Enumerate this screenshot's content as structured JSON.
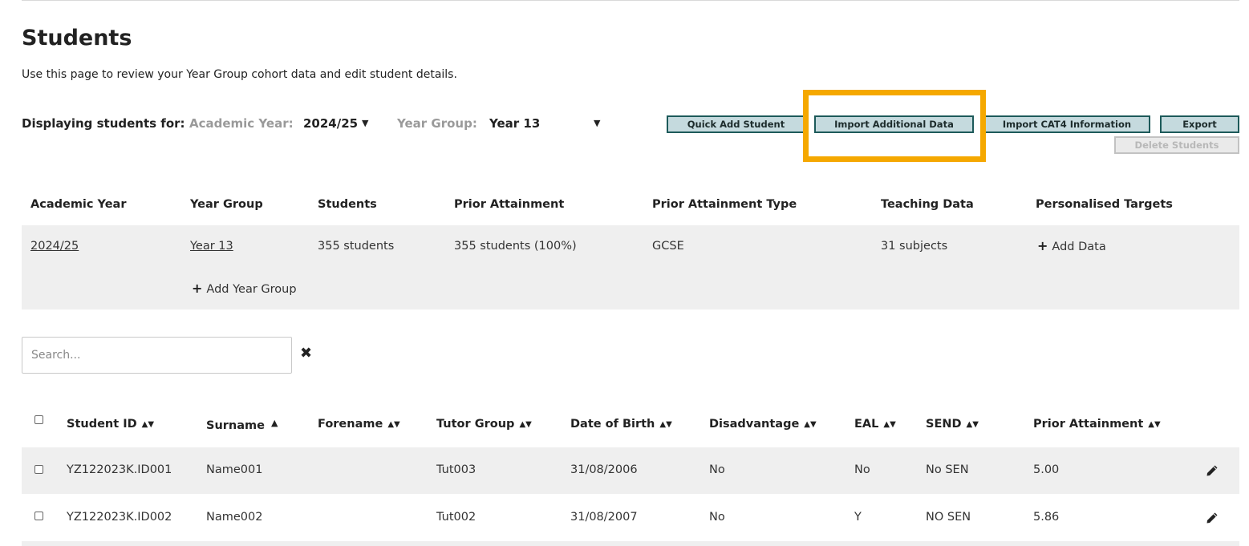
{
  "page": {
    "title": "Students",
    "subtitle": "Use this page to review your Year Group cohort data and edit student details."
  },
  "filters": {
    "displaying_label": "Displaying students for:",
    "academic_year_label": "Academic Year:",
    "academic_year_value": "2024/25",
    "year_group_label": "Year Group:",
    "year_group_value": "Year 13"
  },
  "actions": {
    "quick_add": "Quick Add Student",
    "import_additional": "Import Additional Data",
    "import_cat4": "Import CAT4 Information",
    "export": "Export",
    "delete": "Delete Students"
  },
  "highlight_color": "#f5a800",
  "summary": {
    "headers": [
      "Academic Year",
      "Year Group",
      "Students",
      "Prior Attainment",
      "Prior Attainment Type",
      "Teaching Data",
      "Personalised Targets"
    ],
    "row": {
      "academic_year": "2024/25",
      "year_group": "Year 13",
      "students": "355 students",
      "prior_attainment": "355 students (100%)",
      "prior_attainment_type": "GCSE",
      "teaching_data": "31 subjects",
      "personalised_targets": "Add Data"
    },
    "add_year_group": "Add Year Group"
  },
  "search": {
    "placeholder": "Search..."
  },
  "table": {
    "headers": [
      "Student ID",
      "Surname",
      "Forename",
      "Tutor Group",
      "Date of Birth",
      "Disadvantage",
      "EAL",
      "SEND",
      "Prior Attainment"
    ],
    "rows": [
      {
        "student_id": "YZ122023K.ID001",
        "surname": "Name001",
        "forename": "",
        "tutor_group": "Tut003",
        "dob": "31/08/2006",
        "disadvantage": "No",
        "eal": "No",
        "send": "No SEN",
        "prior_attainment": "5.00"
      },
      {
        "student_id": "YZ122023K.ID002",
        "surname": "Name002",
        "forename": "",
        "tutor_group": "Tut002",
        "dob": "31/08/2007",
        "disadvantage": "No",
        "eal": "Y",
        "send": "NO SEN",
        "prior_attainment": "5.86"
      }
    ]
  }
}
